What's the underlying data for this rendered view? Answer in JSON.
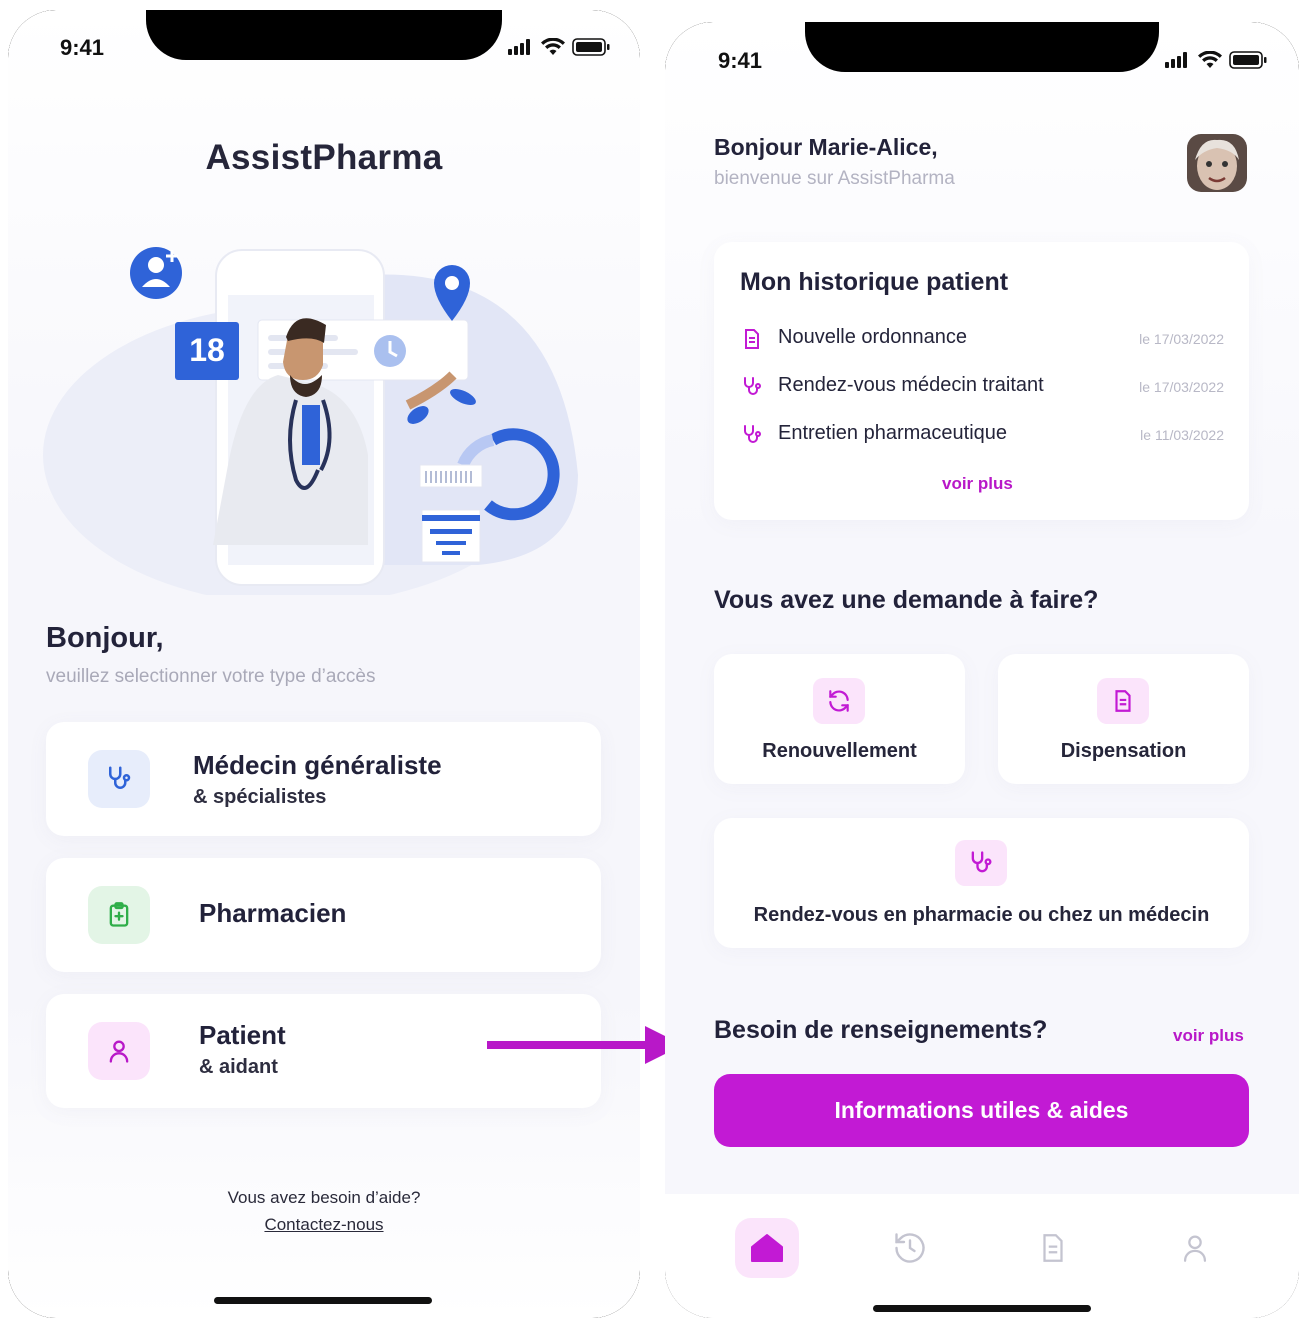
{
  "left_screen": {
    "status": {
      "time": "9:41"
    },
    "app_title": "AssistPharma",
    "illustration": {
      "calendar_day": "18"
    },
    "greeting": {
      "title": "Bonjour,",
      "subtitle": "veuillez selectionner votre type d’accès"
    },
    "roles": [
      {
        "title": "Médecin généraliste",
        "subtitle": "& spécialistes",
        "icon": "stethoscope-icon",
        "icon_bg": "#e7edfb",
        "icon_color": "#2f63d8"
      },
      {
        "title": "Pharmacien",
        "subtitle": "",
        "icon": "clipboard-plus-icon",
        "icon_bg": "#e3f5e6",
        "icon_color": "#2fae49"
      },
      {
        "title": "Patient",
        "subtitle": "& aidant",
        "icon": "user-icon",
        "icon_bg": "#fbe4fb",
        "icon_color": "#b818c8"
      }
    ],
    "help": {
      "text": "Vous avez besoin d’aide?",
      "link": "Contactez-nous"
    }
  },
  "right_screen": {
    "status": {
      "time": "9:41"
    },
    "header": {
      "greeting": "Bonjour Marie-Alice,",
      "subtitle": "bienvenue sur AssistPharma"
    },
    "history": {
      "title": "Mon historique patient",
      "items": [
        {
          "label": "Nouvelle ordonnance",
          "date": "le 17/03/2022",
          "icon": "document-icon"
        },
        {
          "label": "Rendez-vous médecin traitant",
          "date": "le 17/03/2022",
          "icon": "stethoscope-icon"
        },
        {
          "label": "Entretien pharmaceutique",
          "date": "le 11/03/2022",
          "icon": "stethoscope-icon"
        }
      ],
      "see_more": "voir plus"
    },
    "requests": {
      "title": "Vous avez une demande à faire?",
      "items": [
        {
          "label": "Renouvellement",
          "icon": "refresh-icon"
        },
        {
          "label": "Dispensation",
          "icon": "document-icon"
        },
        {
          "label": "Rendez-vous en pharmacie ou chez un médecin",
          "icon": "stethoscope-icon"
        }
      ]
    },
    "info": {
      "title": "Besoin de renseignements?",
      "see_more": "voir plus",
      "button": "Informations utiles & aides"
    },
    "tabbar": [
      {
        "icon": "home-icon",
        "active": true
      },
      {
        "icon": "history-icon",
        "active": false
      },
      {
        "icon": "document-icon",
        "active": false
      },
      {
        "icon": "profile-icon",
        "active": false
      }
    ]
  },
  "colors": {
    "accent": "#c21ad4",
    "accent_light": "#fbe4fb",
    "blue": "#2f63d8",
    "green": "#2fae49"
  }
}
